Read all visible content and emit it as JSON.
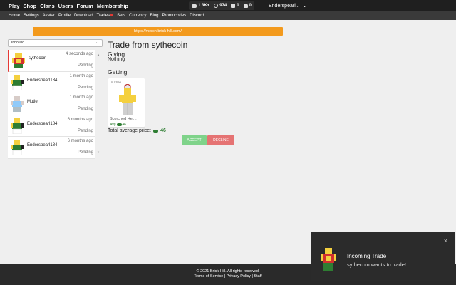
{
  "topnav": {
    "items": [
      "Play",
      "Shop",
      "Clans",
      "Users",
      "Forum",
      "Membership"
    ],
    "stats": {
      "bucks": "1.3K+",
      "bits": "974",
      "messages": "0",
      "notifications": "0"
    },
    "username": "Enderspearl..."
  },
  "subnav": {
    "items": [
      "Home",
      "Settings",
      "Avatar",
      "Profile",
      "Download",
      "Trades",
      "Sets",
      "Currency",
      "Blog",
      "Promocodes",
      "Discord"
    ]
  },
  "banner": {
    "text": "https://merch.brick-hill.com/"
  },
  "filter": {
    "selected": "Inbound"
  },
  "trades": [
    {
      "name": "sythecoin",
      "time": "4 seconds ago",
      "status": "Pending"
    },
    {
      "name": "Enderspearl184",
      "time": "1 month ago",
      "status": "Pending"
    },
    {
      "name": "Mutle",
      "time": "1 month ago",
      "status": "Pending"
    },
    {
      "name": "Enderspearl184",
      "time": "6 months ago",
      "status": "Pending"
    },
    {
      "name": "Enderspearl184",
      "time": "6 months ago",
      "status": "Pending"
    }
  ],
  "trade": {
    "title": "Trade from sythecoin",
    "giving_label": "Giving",
    "giving_value": "Nothing",
    "getting_label": "Getting",
    "item": {
      "serial": "#1304",
      "name": "Scorched Hel...",
      "avg_label": "Avg",
      "avg_value": "46"
    },
    "total_label": "Total average price:",
    "total_value": "46",
    "accept_label": "ACCEPT",
    "decline_label": "DECLINE"
  },
  "footer": {
    "copyright": "© 2021 Brick Hill. All rights reserved.",
    "links": [
      "Terms of Service",
      "Privacy Policy",
      "Staff"
    ]
  },
  "toast": {
    "title": "Incoming Trade",
    "message": "sythecoin wants to trade!",
    "close": "×"
  },
  "colors": {
    "accent_orange": "#f39a1d",
    "accept": "#7fd38a",
    "decline": "#e57373",
    "bits_green": "#2e7d32",
    "active_marker": "#e53935"
  }
}
